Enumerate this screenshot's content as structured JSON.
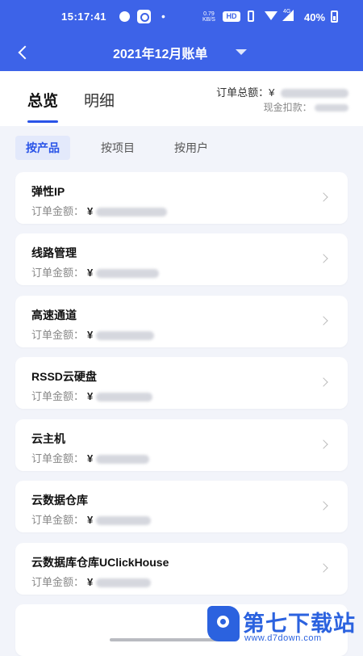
{
  "status_bar": {
    "time": "15:17:41",
    "net_speed_top": "0.79",
    "net_speed_bottom": "KB/S",
    "hd_badge": "HD",
    "signal_label": "4G",
    "battery": "40%"
  },
  "header": {
    "title": "2021年12月账单",
    "accent_color": "#3d63e8"
  },
  "summary": {
    "tabs": [
      {
        "label": "总览",
        "active": true
      },
      {
        "label": "明细",
        "active": false
      }
    ],
    "order_total_label": "订单总额：",
    "currency": "¥",
    "cash_deduction_label": "现金扣款："
  },
  "filters": [
    {
      "label": "按产品",
      "active": true
    },
    {
      "label": "按项目",
      "active": false
    },
    {
      "label": "按用户",
      "active": false
    }
  ],
  "products": [
    {
      "name": "弹性IP",
      "amount_label": "订单金额：",
      "currency": "¥"
    },
    {
      "name": "线路管理",
      "amount_label": "订单金额：",
      "currency": "¥"
    },
    {
      "name": "高速通道",
      "amount_label": "订单金额：",
      "currency": "¥"
    },
    {
      "name": "RSSD云硬盘",
      "amount_label": "订单金额：",
      "currency": "¥"
    },
    {
      "name": "云主机",
      "amount_label": "订单金额：",
      "currency": "¥"
    },
    {
      "name": "云数据仓库",
      "amount_label": "订单金额：",
      "currency": "¥"
    },
    {
      "name": "云数据库仓库UClickHouse",
      "amount_label": "订单金额：",
      "currency": "¥"
    }
  ],
  "watermark": {
    "text": "第七下载站",
    "url": "www.d7down.com"
  }
}
